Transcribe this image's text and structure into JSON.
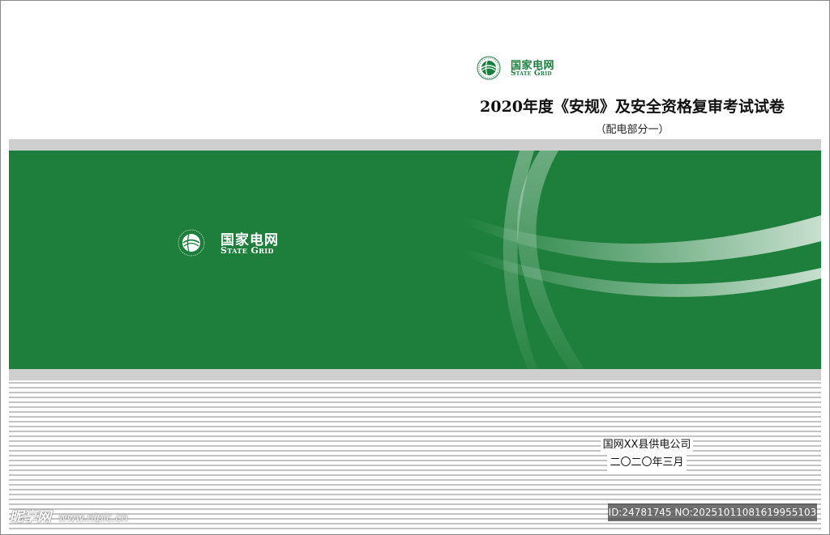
{
  "header_logo": {
    "name_cn": "国家电网",
    "name_en": "State Grid"
  },
  "document": {
    "title": "2020年度《安规》及安全资格复审考试试卷",
    "subtitle": "（配电部分一）"
  },
  "band_logo": {
    "name_cn": "国家电网",
    "name_en": "State Grid"
  },
  "issuer": {
    "company": "国网XX县供电公司",
    "date": "二〇二〇年三月"
  },
  "watermark": {
    "brand": "昵享网",
    "url": "www.nipic.cn",
    "id_text": "ID:24781745 NO:20251011081619955103"
  },
  "colors": {
    "brand_green": "#1e7f3c",
    "band_gray": "#cfcfcf",
    "stripe_gray": "#c4c4c4"
  },
  "icons": {
    "logo": "state-grid-emblem-icon"
  }
}
